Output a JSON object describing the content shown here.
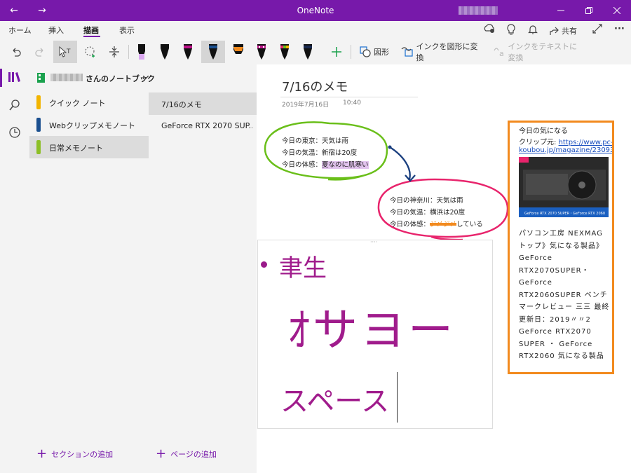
{
  "window": {
    "title": "OneNote"
  },
  "menu": {
    "tabs": [
      "ホーム",
      "挿入",
      "描画",
      "表示"
    ],
    "share": "共有"
  },
  "toolbar": {
    "shapes": "図形",
    "ink_to_shape": "インクを図形に変換",
    "ink_to_text": "インクをテキストに変換"
  },
  "colors": {
    "accent": "#7719aa",
    "green": "#6abf1a",
    "pink": "#e8246c",
    "orange": "#f28a1e",
    "ink_purple": "#a01c8c"
  },
  "notebook": {
    "name": "さんのノートブック"
  },
  "sections": [
    {
      "label": "クイック ノート",
      "color": "#f2b400"
    },
    {
      "label": "Webクリップメモノート",
      "color": "#1a4f8f"
    },
    {
      "label": "日常メモノート",
      "color": "#8cbf26"
    }
  ],
  "pages": [
    {
      "label": "7/16のメモ"
    },
    {
      "label": "GeForce RTX 2070 SUP..."
    }
  ],
  "add_section": "セクションの追加",
  "add_page": "ページの追加",
  "page": {
    "title": "7/16のメモ",
    "date": "2019年7月16日",
    "time": "10:40",
    "note1": {
      "line1": "今日の東京：天気は雨",
      "line2": "今日の気温：新宿は20度",
      "line3_prefix": "今日の体感：",
      "line3_highlight": "夏なのに肌寒い"
    },
    "note2": {
      "line1": "今日の神奈川：天気は雨",
      "line2": "今日の気温：横浜は20度",
      "line3_prefix": "今日の体感：",
      "line3_strike": "ジメジメ",
      "line3_suffix": "している"
    },
    "ink": {
      "line1": "聿生",
      "line2": "ｵサヨー",
      "line3": "スペース"
    }
  },
  "clip": {
    "title": "今日の気になる",
    "source_prefix": "クリップ元: ",
    "source_link": "https://www.pc-koubou.jp/magazine/23093",
    "image_caption": "GeForce RTX 2070 SUPER・GeForce RTX 2060",
    "body": "パソコン工房 NEXMAG トップ》気になる製品》GeForce RTX2070SUPER・GeForce RTX2060SUPER ベンチマークレビュー 三三 最終更新日：2019〃〃2 GeForce RTX2070 SUPER ・ GeForce RTX2060 気になる製品"
  }
}
